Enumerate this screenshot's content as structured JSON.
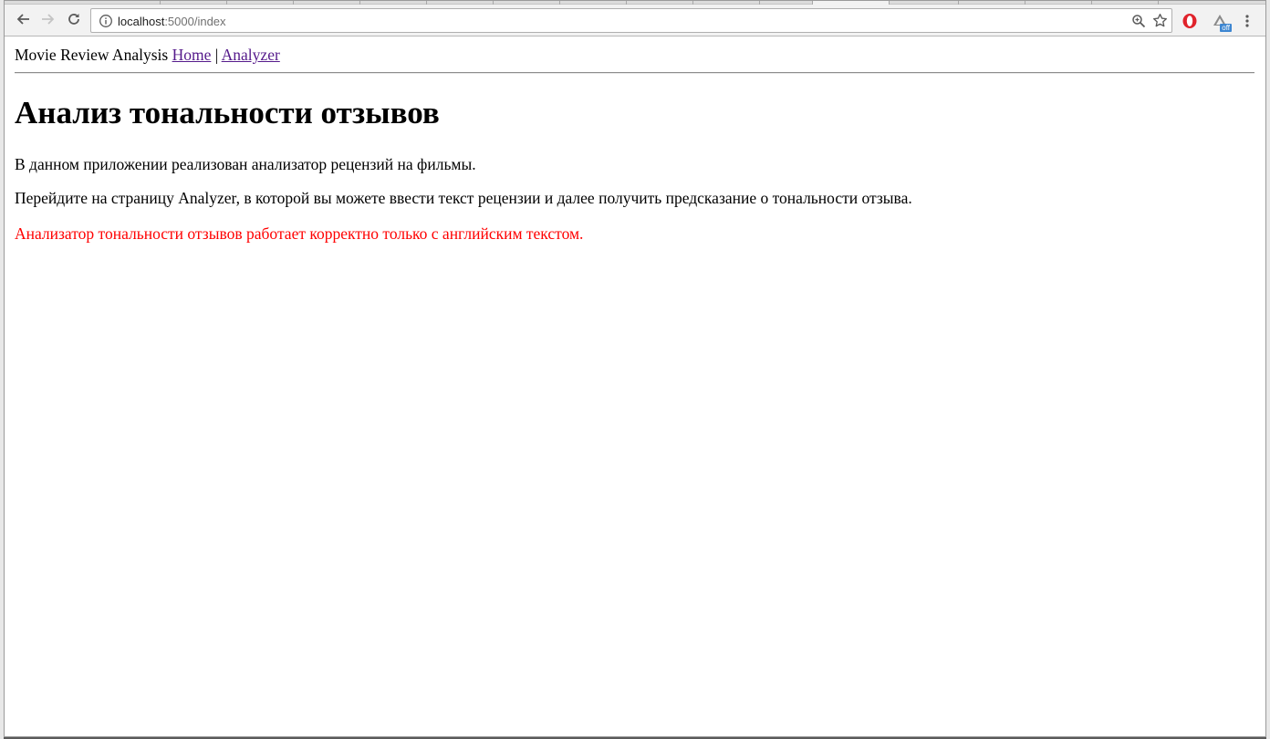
{
  "browser": {
    "url_host": "localhost",
    "url_path": ":5000/index",
    "extension_badge": "off"
  },
  "page": {
    "brand": "Movie Review Analysis",
    "nav": {
      "home": "Home",
      "separator": "|",
      "analyzer": "Analyzer"
    },
    "heading": "Анализ тональности отзывов",
    "paragraph1": "В данном приложении реализован анализатор рецензий на фильмы.",
    "paragraph2": "Перейдите на страницу Analyzer, в которой вы можете ввести текст рецензии и далее получить предсказание о тональности отзыва.",
    "warning": "Анализатор тональности отзывов работает корректно только с английским текстом.",
    "colors": {
      "visited_link": "#551a8b",
      "warning_text": "#ff0000"
    }
  },
  "icons": {
    "back": "back-arrow-icon",
    "forward": "forward-arrow-icon",
    "reload": "reload-icon",
    "info": "info-icon",
    "zoom": "zoom-icon",
    "bookmark": "star-icon",
    "opera": "opera-icon",
    "extension": "extension-icon",
    "menu": "kebab-menu-icon"
  }
}
